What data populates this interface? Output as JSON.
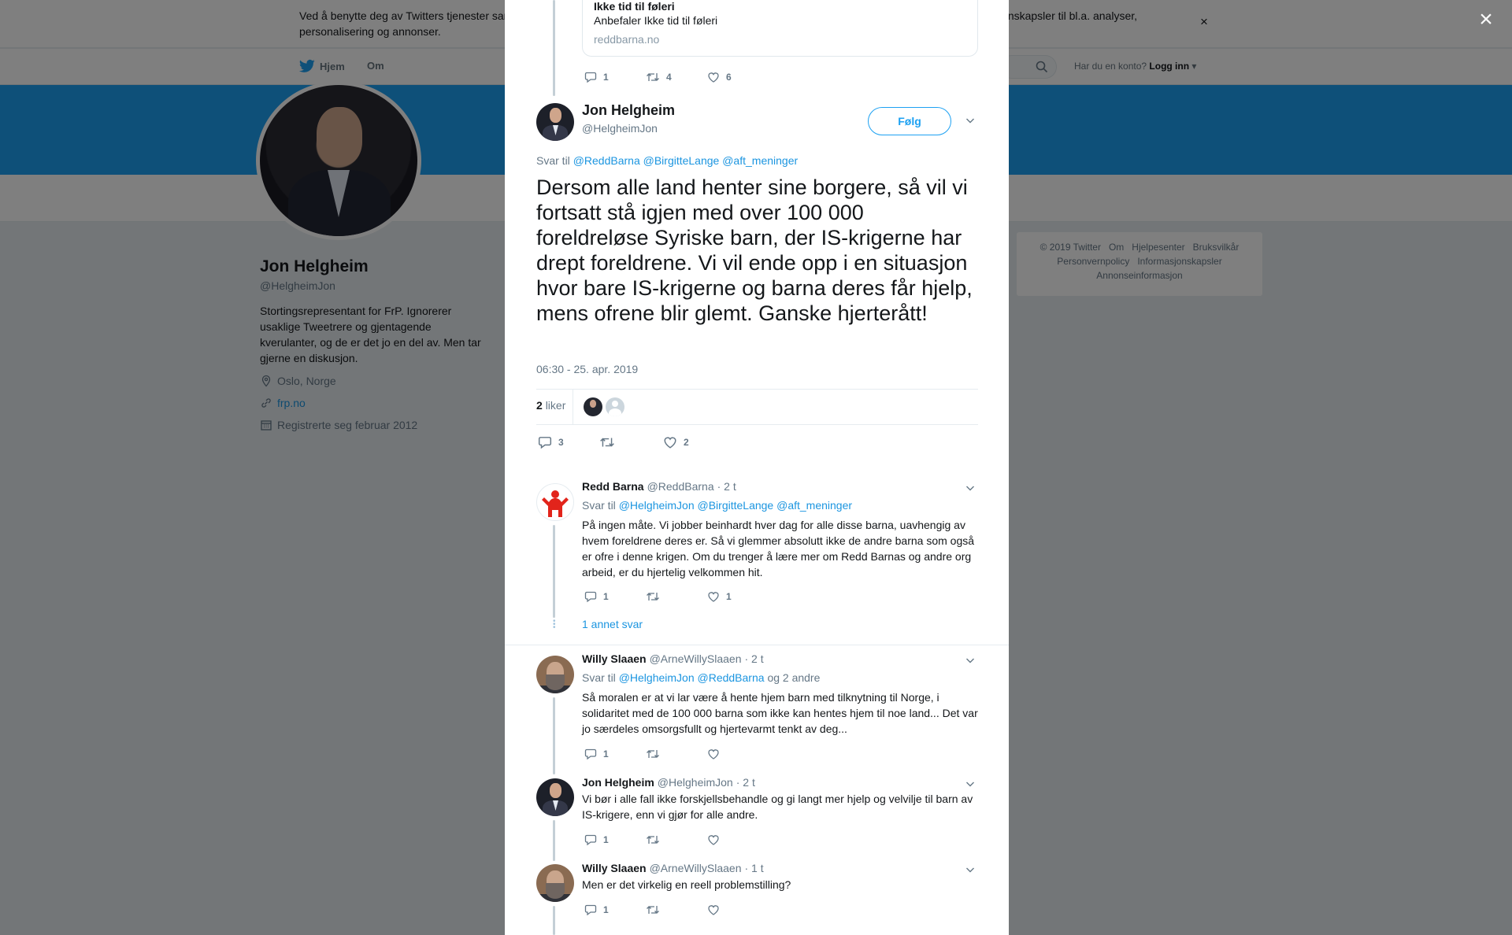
{
  "cookie": {
    "text": "Ved å benytte deg av Twitters tjenester samtykker du til vår bruk av informasjonskapsler og datainnsamling. Vi og våre partnere bruker informasjonskapsler til bl.a. analyser, personalisering og annonser.",
    "close": "×"
  },
  "nav": {
    "home": "Hjem",
    "about": "Om",
    "account_prompt": "Har du en konto?",
    "login": "Logg inn"
  },
  "profile": {
    "name": "Jon Helgheim",
    "handle": "@HelgheimJon",
    "bio": "Stortingsrepresentant for FrP. Ignorerer usaklige Tweetrere og gjentagende kverulanter, og de er det jo en del av. Men tar gjerne en diskusjon.",
    "location": "Oslo, Norge",
    "url": "frp.no",
    "joined": "Registrerte seg februar 2012"
  },
  "footer": {
    "copyright": "© 2019 Twitter",
    "about": "Om",
    "help": "Hjelpesenter",
    "terms": "Bruksvilkår",
    "privacy": "Personvernpolicy",
    "cookies": "Informasjonskapsler",
    "ads": "Annonseinformasjon"
  },
  "overlay_close": "×",
  "card": {
    "title": "Ikke tid til føleri",
    "description": "Anbefaler Ikke tid til føleri",
    "domain": "reddbarna.no"
  },
  "prev_tweet_actions": {
    "replies": "1",
    "retweets": "4",
    "likes": "6"
  },
  "main_tweet": {
    "name": "Jon Helgheim",
    "handle": "@HelgheimJon",
    "follow": "Følg",
    "reply_prefix": "Svar til",
    "reply_mentions": "@ReddBarna @BirgitteLange @aft_meninger",
    "text": "Dersom alle land henter sine borgere, så vil vi fortsatt stå igjen med over 100 000 foreldreløse Syriske barn, der IS-krigerne har drept foreldrene. Vi vil ende opp i en situasjon hvor bare IS-krigerne og barna deres får hjelp, mens ofrene blir glemt. Ganske hjerterått!",
    "timestamp": "06:30 - 25. apr. 2019",
    "likes_count": "2",
    "likes_label": "liker",
    "replies": "3",
    "retweets": "",
    "likes": "2"
  },
  "replies": [
    {
      "name": "Redd Barna",
      "handle": "@ReddBarna",
      "time": "· 2 t",
      "reply_prefix": "Svar til",
      "reply_mentions": "@HelgheimJon @BirgitteLange @aft_meninger",
      "reply_suffix": "",
      "text": "På ingen måte. Vi jobber beinhardt hver dag for alle disse barna, uavhengig av hvem foreldrene deres er. Så vi glemmer absolutt ikke de andre barna som også er ofre i denne krigen. Om du trenger å lære mer om Redd Barnas og andre org arbeid, er du hjertelig velkommen hit.",
      "replies": "1",
      "retweets": "",
      "likes": "1"
    },
    {
      "name": "Willy Slaaen",
      "handle": "@ArneWillySlaaen",
      "time": "· 2 t",
      "reply_prefix": "Svar til",
      "reply_mentions": "@HelgheimJon @ReddBarna",
      "reply_suffix": "og 2 andre",
      "text": "Så moralen er at vi lar være å hente hjem barn med tilknytning til Norge, i solidaritet med de 100 000 barna som ikke kan hentes hjem til noe land... Det var jo særdeles omsorgsfullt og hjertevarmt tenkt av deg...",
      "replies": "1",
      "retweets": "",
      "likes": ""
    },
    {
      "name": "Jon Helgheim",
      "handle": "@HelgheimJon",
      "time": "· 2 t",
      "text": "Vi bør i alle fall ikke forskjellsbehandle og gi langt mer hjelp og velvilje til barn av IS-krigere, enn vi gjør for alle andre.",
      "replies": "1",
      "retweets": "",
      "likes": ""
    },
    {
      "name": "Willy Slaaen",
      "handle": "@ArneWillySlaaen",
      "time": "· 1 t",
      "text": "Men er det virkelig en reell problemstilling?",
      "replies": "1",
      "retweets": "",
      "likes": ""
    }
  ],
  "more_replies": "1 annet svar",
  "colors": {
    "brand": "#1da1f2",
    "link": "#1b95e0",
    "text": "#14171a",
    "muted": "#657786"
  }
}
